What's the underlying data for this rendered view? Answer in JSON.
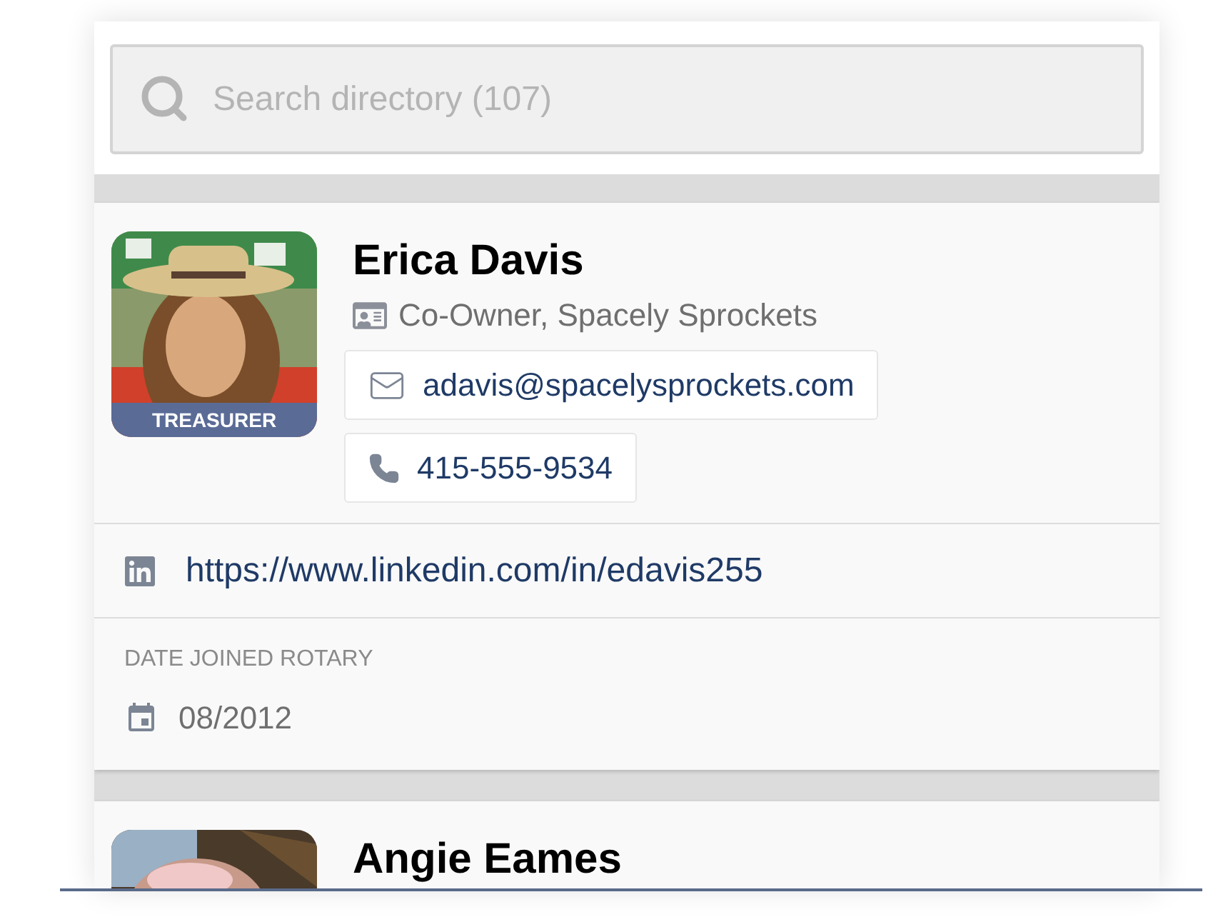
{
  "search": {
    "placeholder": "Search directory (107)"
  },
  "members": [
    {
      "name": "Erica Davis",
      "role_badge": "TREASURER",
      "title": "Co-Owner, Spacely Sprockets",
      "email": "adavis@spacelysprockets.com",
      "phone": "415-555-9534",
      "linkedin": "https://www.linkedin.com/in/edavis255",
      "date_label": "DATE JOINED ROTARY",
      "date_joined": "08/2012"
    },
    {
      "name": "Angie Eames"
    }
  ]
}
